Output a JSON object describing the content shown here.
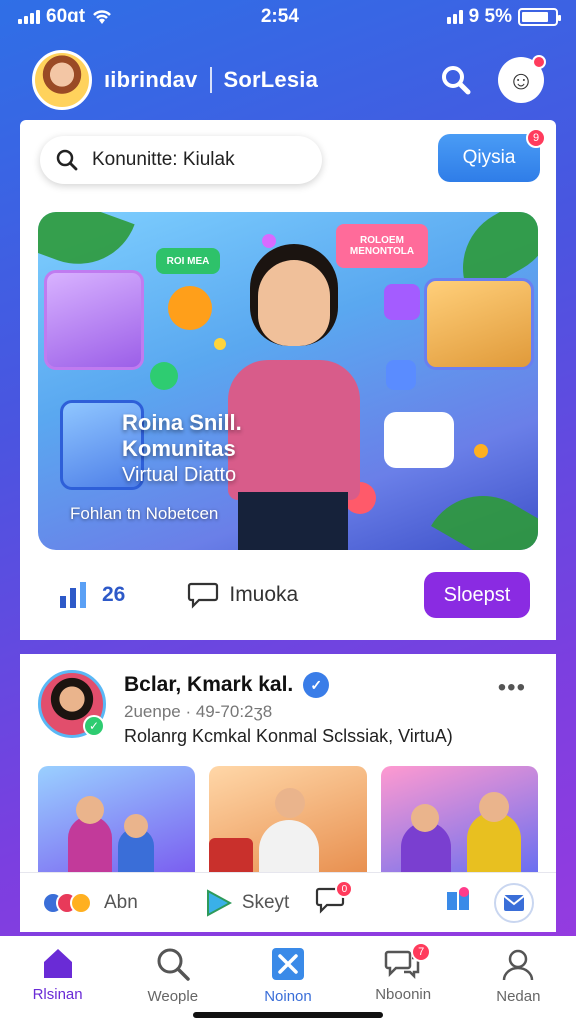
{
  "status": {
    "carrier": "60ɑt",
    "time": "2:54",
    "battery": "9 5%"
  },
  "header": {
    "title": "ıibrindav",
    "subtitle": "SorLesia"
  },
  "search": {
    "text": "Konunitte: Kiulak"
  },
  "pill_button": {
    "label": "Qiysia",
    "badge": "9"
  },
  "hero": {
    "chip_green": "ROI MEA",
    "chip_pink": "ROLOEM MENONTOLA",
    "title_line1": "Roina Snill.",
    "title_line2": "Komunitas",
    "title_line3": "Virtual Diatto",
    "caption": "Fohlan tn Nobetcen"
  },
  "actions": {
    "like_count": "26",
    "comment_label": "Imuoka",
    "button_label": "Sloepst"
  },
  "post": {
    "author": "Bclar, Kmark kal.",
    "time": "2uenpe · 49-70:2ʒ8",
    "text": "Rolanrg Kcmkal Konmal Sclssiak, VirtuA)"
  },
  "action_bar": {
    "item1": "Abn",
    "item2": "Skeyt",
    "item3_badge": "0"
  },
  "tabs": [
    {
      "label": "Rlsinan"
    },
    {
      "label": "Weople"
    },
    {
      "label": "Noinon"
    },
    {
      "label": "Nboonin",
      "badge": "7"
    },
    {
      "label": "Nedan"
    }
  ],
  "colors": {
    "accent": "#8a2be2",
    "primary_blue": "#2f7de8",
    "badge": "#ff3b5c"
  }
}
